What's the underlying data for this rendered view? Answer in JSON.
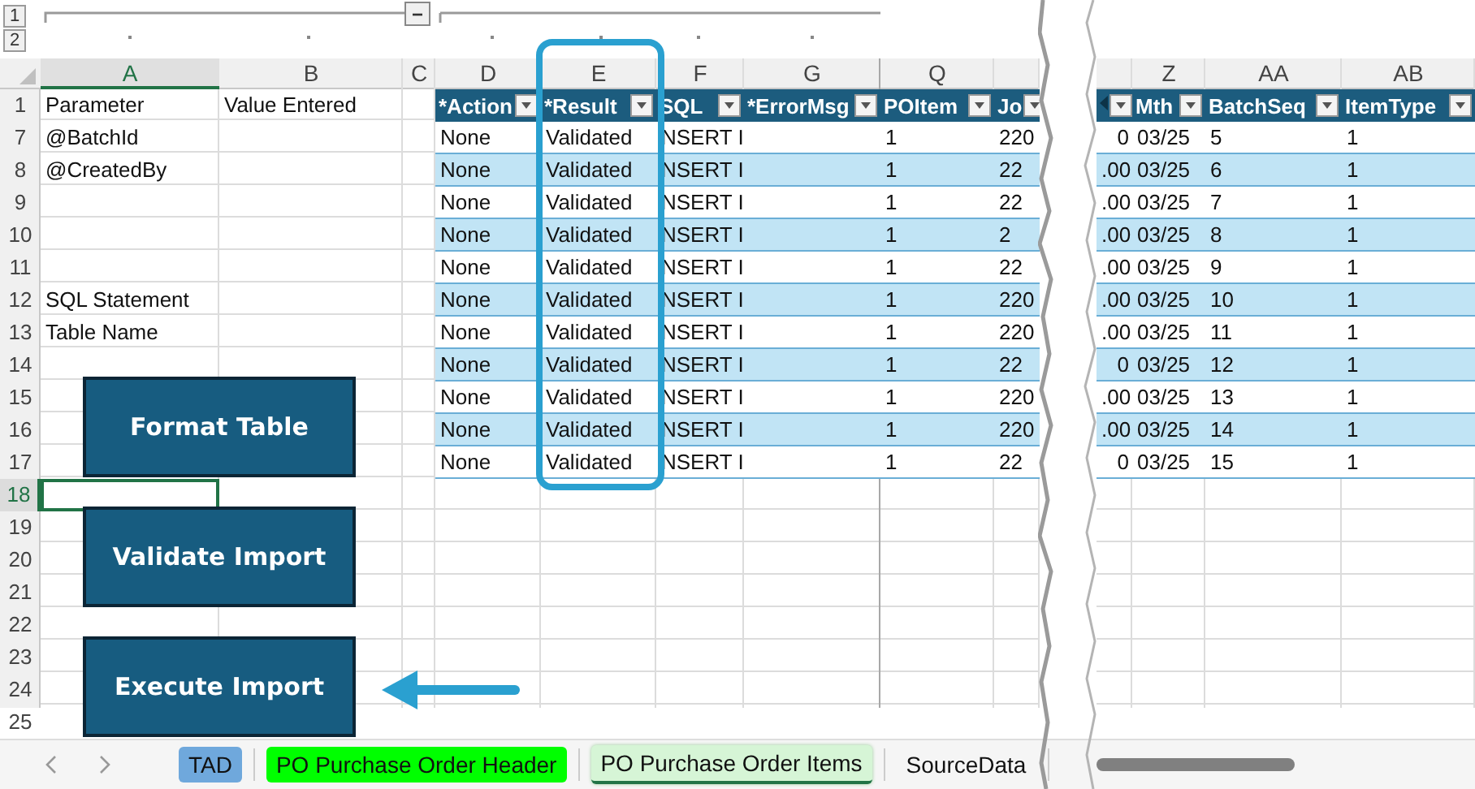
{
  "outline": {
    "levels": [
      "1",
      "2"
    ],
    "collapse_button": "−"
  },
  "column_letters": [
    {
      "letter": "A",
      "selected": true
    },
    {
      "letter": "B",
      "selected": false
    },
    {
      "letter": "C",
      "selected": false
    },
    {
      "letter": "D",
      "selected": false
    },
    {
      "letter": "E",
      "selected": false
    },
    {
      "letter": "F",
      "selected": false
    },
    {
      "letter": "G",
      "selected": false
    },
    {
      "letter": "Q",
      "selected": false
    },
    {
      "letter": "Z",
      "selected": false
    },
    {
      "letter": "AA",
      "selected": false
    },
    {
      "letter": "AB",
      "selected": false
    }
  ],
  "rows": [
    {
      "number": "1",
      "selected": false,
      "parameter": "Parameter",
      "value": "Value Entered"
    },
    {
      "number": "7",
      "selected": false,
      "parameter": "@BatchId"
    },
    {
      "number": "8",
      "selected": false,
      "parameter": "@CreatedBy"
    },
    {
      "number": "9",
      "selected": false
    },
    {
      "number": "10",
      "selected": false
    },
    {
      "number": "11",
      "selected": false
    },
    {
      "number": "12",
      "selected": false,
      "parameter": "SQL Statement"
    },
    {
      "number": "13",
      "selected": false,
      "parameter": "Table Name"
    },
    {
      "number": "14",
      "selected": false
    },
    {
      "number": "15",
      "selected": false
    },
    {
      "number": "16",
      "selected": false
    },
    {
      "number": "17",
      "selected": false
    },
    {
      "number": "18",
      "selected": true
    },
    {
      "number": "19",
      "selected": false
    },
    {
      "number": "20",
      "selected": false
    },
    {
      "number": "21",
      "selected": false
    },
    {
      "number": "22",
      "selected": false
    },
    {
      "number": "23",
      "selected": false
    },
    {
      "number": "24",
      "selected": false
    },
    {
      "number": "25",
      "selected": false
    }
  ],
  "table": {
    "headers": [
      {
        "label": "*Action"
      },
      {
        "label": "*Result"
      },
      {
        "label": "SQL"
      },
      {
        "label": "*ErrorMsg"
      },
      {
        "label": "POItem"
      },
      {
        "label": "Jo"
      },
      {
        "kind": "cut"
      },
      {
        "label": "Mth"
      },
      {
        "label": "BatchSeq"
      },
      {
        "label": "ItemType"
      }
    ],
    "rows": [
      {
        "action": "None",
        "result": "Validated",
        "sql": "NSERT I",
        "po_item": "1",
        "jo": "220",
        "cut_value": "0",
        "mth": "03/25",
        "batch_seq": "5",
        "item_type": "1"
      },
      {
        "action": "None",
        "result": "Validated",
        "sql": "NSERT I",
        "po_item": "1",
        "jo": "22",
        "cut_value": ".00",
        "mth": "03/25",
        "batch_seq": "6",
        "item_type": "1"
      },
      {
        "action": "None",
        "result": "Validated",
        "sql": "NSERT I",
        "po_item": "1",
        "jo": "22",
        "cut_value": ".00",
        "mth": "03/25",
        "batch_seq": "7",
        "item_type": "1"
      },
      {
        "action": "None",
        "result": "Validated",
        "sql": "NSERT I",
        "po_item": "1",
        "jo": "2",
        "cut_value": ".00",
        "mth": "03/25",
        "batch_seq": "8",
        "item_type": "1"
      },
      {
        "action": "None",
        "result": "Validated",
        "sql": "NSERT I",
        "po_item": "1",
        "jo": "22",
        "cut_value": ".00",
        "mth": "03/25",
        "batch_seq": "9",
        "item_type": "1"
      },
      {
        "action": "None",
        "result": "Validated",
        "sql": "NSERT I",
        "po_item": "1",
        "jo": "220",
        "cut_value": ".00",
        "mth": "03/25",
        "batch_seq": "10",
        "item_type": "1"
      },
      {
        "action": "None",
        "result": "Validated",
        "sql": "NSERT I",
        "po_item": "1",
        "jo": "220",
        "cut_value": ".00",
        "mth": "03/25",
        "batch_seq": "11",
        "item_type": "1"
      },
      {
        "action": "None",
        "result": "Validated",
        "sql": "NSERT I",
        "po_item": "1",
        "jo": "22",
        "cut_value": "0",
        "mth": "03/25",
        "batch_seq": "12",
        "item_type": "1"
      },
      {
        "action": "None",
        "result": "Validated",
        "sql": "NSERT I",
        "po_item": "1",
        "jo": "220",
        "cut_value": ".00",
        "mth": "03/25",
        "batch_seq": "13",
        "item_type": "1"
      },
      {
        "action": "None",
        "result": "Validated",
        "sql": "NSERT I",
        "po_item": "1",
        "jo": "220",
        "cut_value": ".00",
        "mth": "03/25",
        "batch_seq": "14",
        "item_type": "1"
      },
      {
        "action": "None",
        "result": "Validated",
        "sql": "NSERT I",
        "po_item": "1",
        "jo": "22",
        "cut_value": "0",
        "mth": "03/25",
        "batch_seq": "15",
        "item_type": "1"
      }
    ]
  },
  "macro_buttons": [
    {
      "label": "Format Table"
    },
    {
      "label": "Validate Import"
    },
    {
      "label": "Execute Import"
    }
  ],
  "sheet_tabs": [
    {
      "label": "TAD",
      "color": "#6fa8dc",
      "selected": false
    },
    {
      "label": "PO Purchase Order Header",
      "color": "#00ff00",
      "selected": false
    },
    {
      "label": "PO Purchase Order Items",
      "color": "#d6f5d6",
      "selected": true
    },
    {
      "label": "SourceData",
      "selected": false
    }
  ]
}
